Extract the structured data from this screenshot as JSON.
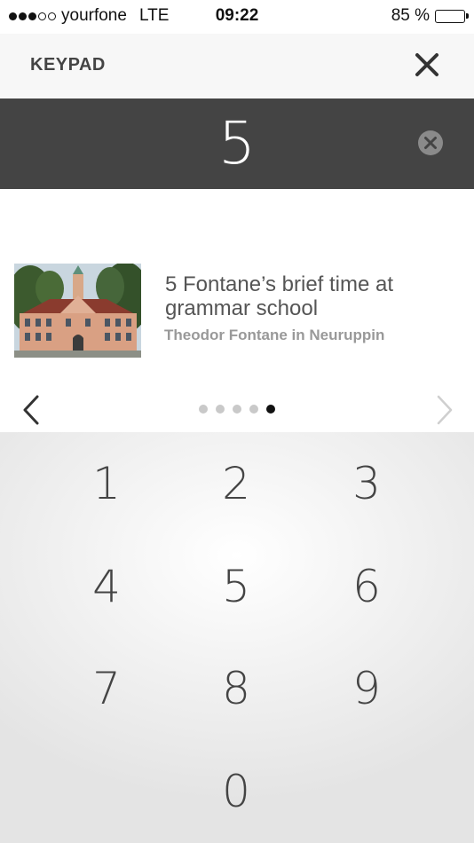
{
  "status_bar": {
    "carrier": "yourfone",
    "network": "LTE",
    "time": "09:22",
    "battery_text": "85 %",
    "battery_level_percent": 85
  },
  "header": {
    "title": "KEYPAD"
  },
  "display": {
    "value": "5"
  },
  "result": {
    "title": "5 Fontane’s brief time at grammar school",
    "subtitle": "Theodor Fontane in Neuruppin"
  },
  "pagination": {
    "total": 5,
    "active_index": 4
  },
  "keypad": {
    "keys": [
      "1",
      "2",
      "3",
      "4",
      "5",
      "6",
      "7",
      "8",
      "9",
      "0"
    ]
  },
  "colors": {
    "display_background": "#444444",
    "header_background": "#f7f7f7",
    "active_dot": "#111111",
    "inactive_dot": "#c9c9c9"
  }
}
